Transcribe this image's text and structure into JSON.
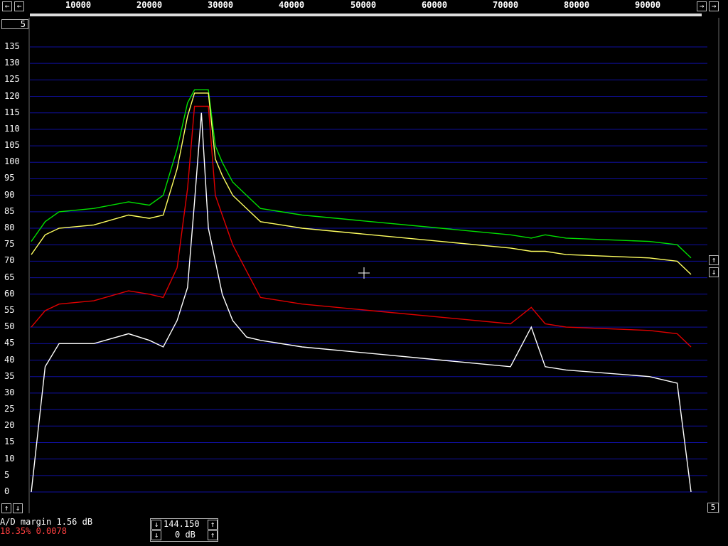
{
  "freq_axis": {
    "ticks": [
      "10000",
      "20000",
      "30000",
      "40000",
      "50000",
      "60000",
      "70000",
      "80000",
      "90000"
    ],
    "left_arrow": "←",
    "right_arrow": "→",
    "right_arrow2": "→",
    "left_arrow2": "←"
  },
  "top_left_box": "5",
  "db_axis": {
    "ticks": [
      "135",
      "130",
      "125",
      "120",
      "115",
      "110",
      "105",
      "100",
      "95",
      "90",
      "85",
      "80",
      "75",
      "70",
      "65",
      "60",
      "55",
      "50",
      "45",
      "40",
      "35",
      "30",
      "25",
      "20",
      "15",
      "10",
      "5",
      "0"
    ]
  },
  "right_controls": {
    "up": "↑",
    "down": "↓",
    "bottom_box": "5"
  },
  "bottom_left": {
    "up": "↑",
    "down": "↓"
  },
  "status": {
    "ad_margin": "A/D margin  1.56 dB",
    "percent_line": "18.35% 0.0078",
    "percent_color": "#ff4040"
  },
  "freq_box": {
    "value": "144.150",
    "gain": "0 dB",
    "up": "↑",
    "down": "↓"
  },
  "colors": {
    "grid": "#1010a0",
    "green": "#00e000",
    "yellow": "#ffff60",
    "red": "#e00000",
    "white": "#ffffff"
  },
  "chart_data": {
    "type": "line",
    "x_range": [
      1000,
      96000
    ],
    "ylim": [
      0,
      135
    ],
    "x": [
      1000,
      3000,
      5000,
      10000,
      15000,
      18000,
      20000,
      22000,
      23500,
      24500,
      25500,
      26500,
      27500,
      28500,
      30000,
      32000,
      34000,
      40000,
      50000,
      60000,
      70000,
      73000,
      75000,
      78000,
      90000,
      94000,
      96000
    ],
    "series": [
      {
        "color": "green",
        "values": [
          76,
          82,
          85,
          86,
          88,
          87,
          90,
          104,
          118,
          122,
          122,
          122,
          105,
          100,
          94,
          90,
          86,
          84,
          82,
          80,
          78,
          77,
          78,
          77,
          76,
          75,
          71
        ]
      },
      {
        "color": "yellow",
        "values": [
          72,
          78,
          80,
          81,
          84,
          83,
          84,
          98,
          114,
          121,
          121,
          121,
          101,
          96,
          90,
          86,
          82,
          80,
          78,
          76,
          74,
          73,
          73,
          72,
          71,
          70,
          66
        ]
      },
      {
        "color": "red",
        "values": [
          50,
          55,
          57,
          58,
          61,
          60,
          59,
          68,
          92,
          117,
          117,
          117,
          90,
          84,
          75,
          67,
          59,
          57,
          55,
          53,
          51,
          56,
          51,
          50,
          49,
          48,
          44
        ]
      },
      {
        "color": "white",
        "values": [
          0,
          38,
          45,
          45,
          48,
          46,
          44,
          52,
          62,
          88,
          115,
          80,
          70,
          60,
          52,
          47,
          46,
          44,
          42,
          40,
          38,
          50,
          38,
          37,
          35,
          33,
          0
        ]
      }
    ]
  }
}
